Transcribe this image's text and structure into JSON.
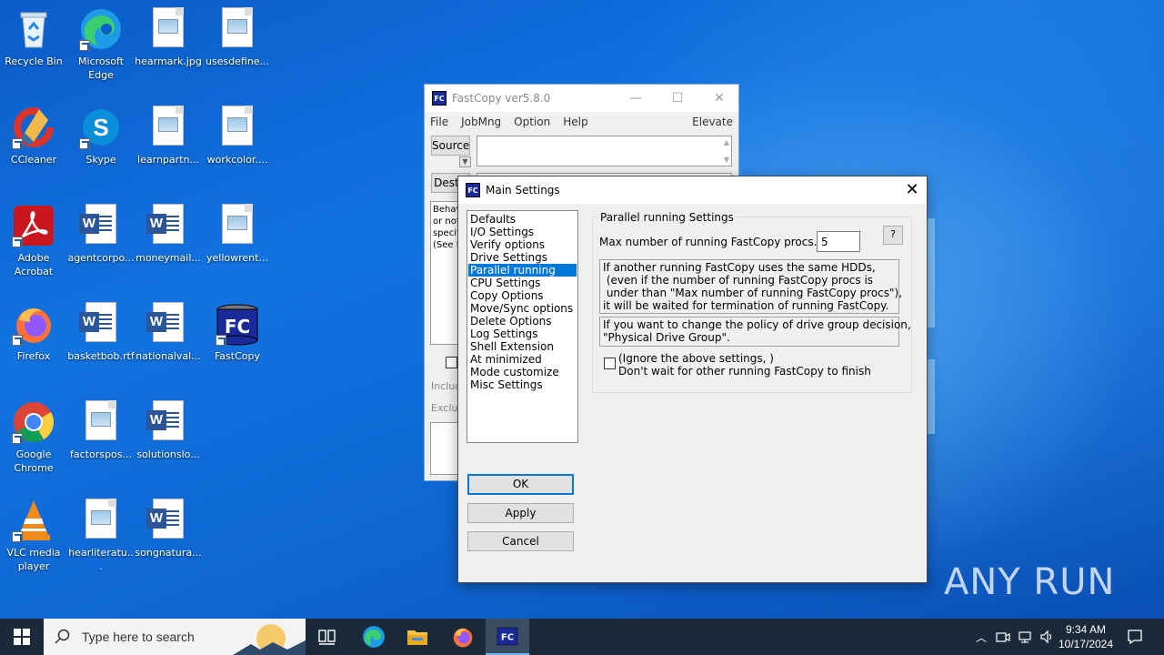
{
  "desktop_icons": [
    {
      "label": "Recycle Bin",
      "icon": "recycle-bin-icon"
    },
    {
      "label": "Microsoft Edge",
      "icon": "edge-icon"
    },
    {
      "label": "hearmark.jpg",
      "icon": "image-file-icon"
    },
    {
      "label": "usesdefine...",
      "icon": "image-file-icon"
    },
    {
      "label": "CCleaner",
      "icon": "ccleaner-icon"
    },
    {
      "label": "Skype",
      "icon": "skype-icon"
    },
    {
      "label": "learnpartn...",
      "icon": "image-file-icon"
    },
    {
      "label": "workcolor....",
      "icon": "image-file-icon"
    },
    {
      "label": "Adobe Acrobat",
      "icon": "acrobat-icon"
    },
    {
      "label": "agentcorpo...",
      "icon": "word-doc-icon"
    },
    {
      "label": "moneymail...",
      "icon": "word-doc-icon"
    },
    {
      "label": "yellowrent...",
      "icon": "image-file-icon"
    },
    {
      "label": "Firefox",
      "icon": "firefox-icon"
    },
    {
      "label": "basketbob.rtf",
      "icon": "word-doc-icon"
    },
    {
      "label": "nationalval...",
      "icon": "word-doc-icon"
    },
    {
      "label": "FastCopy",
      "icon": "fastcopy-icon"
    },
    {
      "label": "Google Chrome",
      "icon": "chrome-icon"
    },
    {
      "label": "factorspos...",
      "icon": "image-file-icon"
    },
    {
      "label": "solutionslo...",
      "icon": "word-doc-icon"
    },
    {
      "label": "VLC media player",
      "icon": "vlc-icon"
    },
    {
      "label": "hearliteratu...",
      "icon": "image-file-icon"
    },
    {
      "label": "songnatura...",
      "icon": "word-doc-icon"
    }
  ],
  "fastcopy": {
    "title": "FastCopy ver5.8.0",
    "icon_text": "FC",
    "menu": [
      "File",
      "JobMng",
      "Option",
      "Help"
    ],
    "elevate": "Elevate",
    "source_label": "Source",
    "dest_label": "DestD",
    "behavior_fragments": [
      "Behav",
      "or not",
      "specifi",
      "(See H"
    ],
    "include_label": "Includ",
    "exclude_label": "Exclud"
  },
  "dialog": {
    "title": "Main Settings",
    "icon_text": "FC",
    "close_glyph": "✕",
    "categories": [
      "Defaults",
      "I/O Settings",
      "Verify options",
      "Drive Settings",
      "Parallel running",
      "CPU Settings",
      "Copy Options",
      "Move/Sync options",
      "Delete Options",
      "Log Settings",
      "Shell Extension",
      "At minimized",
      "Mode customize",
      "Misc Settings"
    ],
    "selected_category": "Parallel running",
    "group_title": "Parallel running Settings",
    "max_procs_label": "Max number of running FastCopy procs.",
    "max_procs_value": "5",
    "help_button": "?",
    "info_text_1": "If another running FastCopy uses the same HDDs,\n (even if the number of running FastCopy procs is\n under than \"Max number of running FastCopy procs\"),\nit will be waited for termination of running FastCopy.",
    "info_text_2": "If you want to change the policy of drive group decision,\n\"Physical Drive Group\".",
    "ignore_checkbox_line1": "(Ignore the above settings, )",
    "ignore_checkbox_line2": "Don't wait for other running FastCopy to finish",
    "ignore_checked": false,
    "ok_label": "OK",
    "apply_label": "Apply",
    "cancel_label": "Cancel"
  },
  "taskbar": {
    "search_placeholder": "Type here to search",
    "time": "9:34 AM",
    "date": "10/17/2024",
    "pinned": [
      "task-view-icon",
      "edge-icon",
      "file-explorer-icon",
      "firefox-icon",
      "fastcopy-icon"
    ]
  },
  "watermark": "ANY RUN",
  "colors": {
    "selection": "#0078d7",
    "taskbar": "#1b2a3b",
    "desktop": "#0e66d2"
  }
}
